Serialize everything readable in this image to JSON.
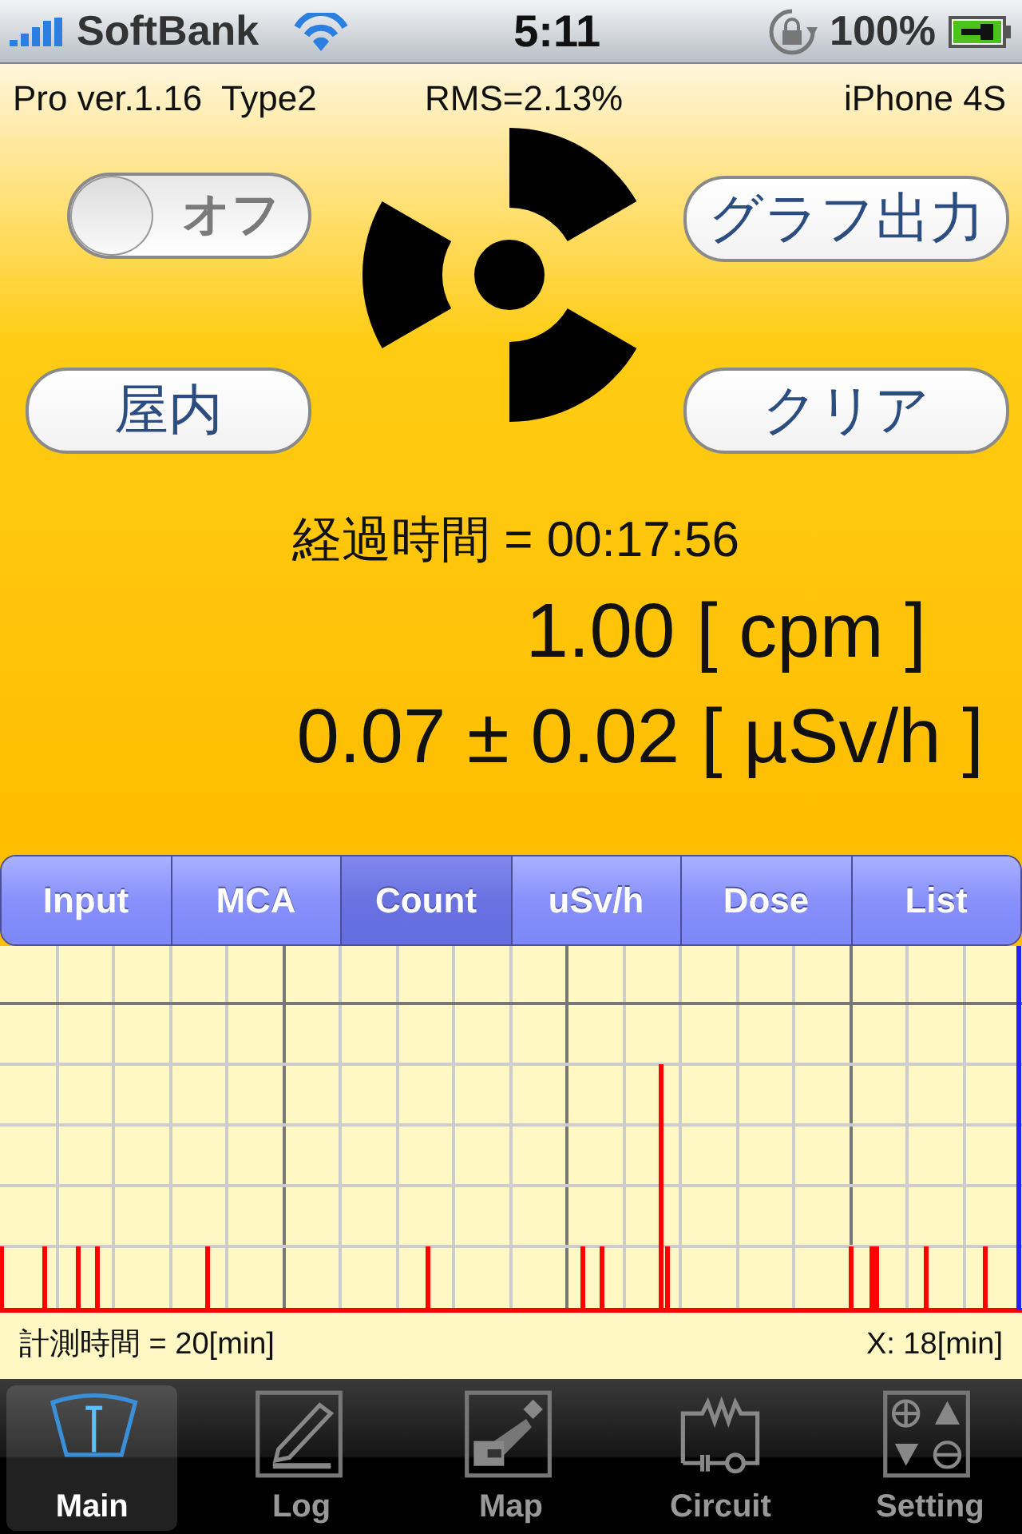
{
  "status_bar": {
    "carrier": "SoftBank",
    "time": "5:11",
    "battery": "100%"
  },
  "info": {
    "version": "Pro ver.1.16  Type2",
    "rms": "RMS=2.13%",
    "device": "iPhone 4S"
  },
  "controls": {
    "switch": {
      "label": "オフ",
      "on": false
    },
    "graph_button": "グラフ出力",
    "location_button": "屋内",
    "clear_button": "クリア"
  },
  "readings": {
    "elapsed": "経過時間 = 00:17:56",
    "cpm": "1.00 [ cpm ]",
    "dose_rate": "0.07 ± 0.02 [ µSv/h ]"
  },
  "segments": [
    {
      "label": "Input",
      "selected": false
    },
    {
      "label": "MCA",
      "selected": false
    },
    {
      "label": "Count",
      "selected": true
    },
    {
      "label": "uSv/h",
      "selected": false
    },
    {
      "label": "Dose",
      "selected": false
    },
    {
      "label": "List",
      "selected": false
    }
  ],
  "chart_footer": {
    "duration": "計測時間 = 20[min]",
    "cursor": "X: 18[min]"
  },
  "tabs": [
    {
      "label": "Main",
      "kind": "main",
      "selected": true
    },
    {
      "label": "Log",
      "kind": "log",
      "selected": false
    },
    {
      "label": "Map",
      "kind": "map",
      "selected": false
    },
    {
      "label": "Circuit",
      "kind": "circuit",
      "selected": false
    },
    {
      "label": "Setting",
      "kind": "setting",
      "selected": false
    }
  ]
}
